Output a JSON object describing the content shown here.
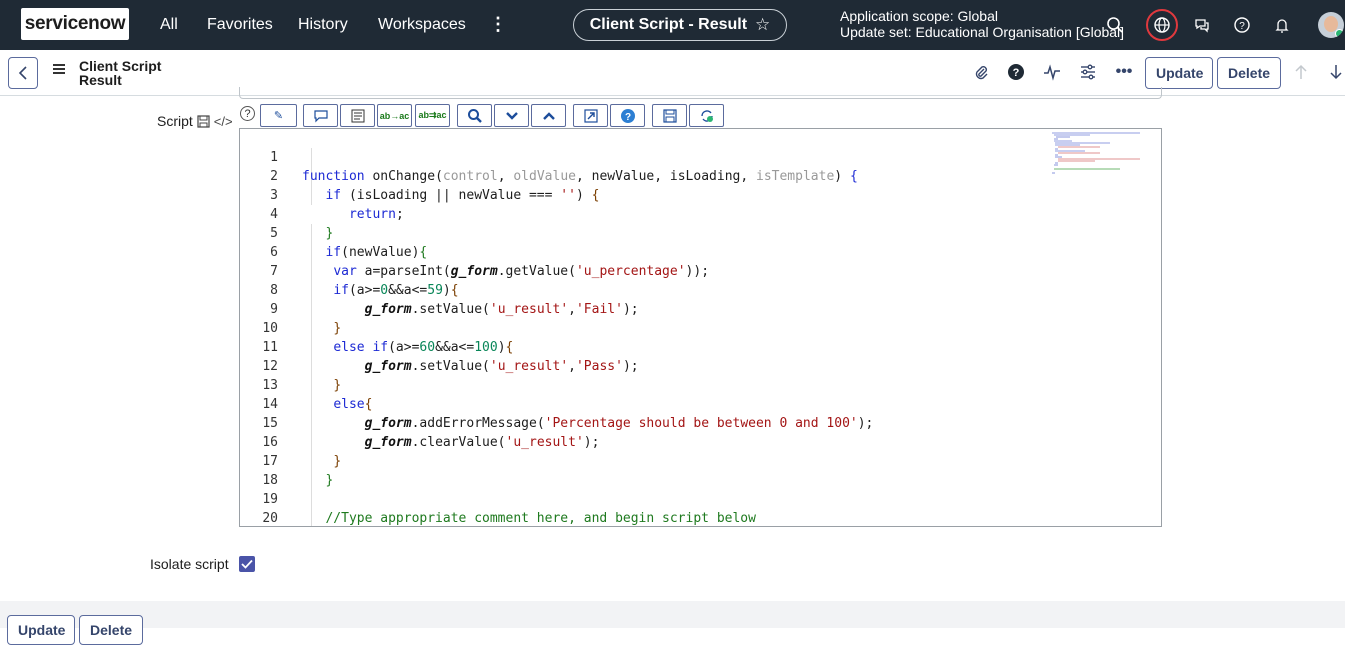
{
  "topnav": {
    "brand": "servicenow",
    "links": [
      "All",
      "Favorites",
      "History",
      "Workspaces"
    ],
    "more_icon": "more-vertical-icon",
    "record_title": "Client Script - Result",
    "scope_line1": "Application scope: Global",
    "scope_line2": "Update set: Educational Organisation [Global]",
    "icons": [
      "search-icon",
      "globe-icon",
      "chat-icon",
      "help-icon",
      "bell-icon",
      "avatar"
    ]
  },
  "record_header": {
    "title_line1": "Client Script",
    "title_line2": "Result",
    "update_label": "Update",
    "delete_label": "Delete",
    "icons": [
      "attachment-icon",
      "help-circle-icon",
      "activity-icon",
      "settings-sliders-icon",
      "more-horizontal-icon",
      "arrow-up-icon",
      "arrow-down-icon"
    ]
  },
  "form": {
    "script_label": "Script",
    "isolate_label": "Isolate script",
    "isolate_checked": true,
    "toolbar_icons": [
      "format-code-icon",
      "comment-icon",
      "list-icon",
      "replace-icon",
      "replace-all-icon",
      "search-icon",
      "chevron-down-icon",
      "chevron-up-icon",
      "fullscreen-icon",
      "help-icon",
      "save-icon",
      "sync-icon"
    ],
    "code_lines": [
      "function onChange(control, oldValue, newValue, isLoading, isTemplate) {",
      "   if (isLoading || newValue === '') {",
      "      return;",
      "   }",
      "   if(newValue){",
      "    var a=parseInt(g_form.getValue('u_percentage'));",
      "    if(a>=0&&a<=59){",
      "        g_form.setValue('u_result','Fail');",
      "    }",
      "    else if(a>=60&&a<=100){",
      "        g_form.setValue('u_result','Pass');",
      "    }",
      "    else{",
      "        g_form.addErrorMessage('Percentage should be between 0 and 100');",
      "        g_form.clearValue('u_result');",
      "    }",
      "   }",
      "",
      "   //Type appropriate comment here, and begin script below",
      "",
      "}"
    ]
  },
  "footer": {
    "update_label": "Update",
    "delete_label": "Delete"
  },
  "colors": {
    "nav_bg": "#1f2a35",
    "accent": "#4a54a8",
    "button_border": "#5b6b9d",
    "globe_ring": "#e0393e"
  }
}
